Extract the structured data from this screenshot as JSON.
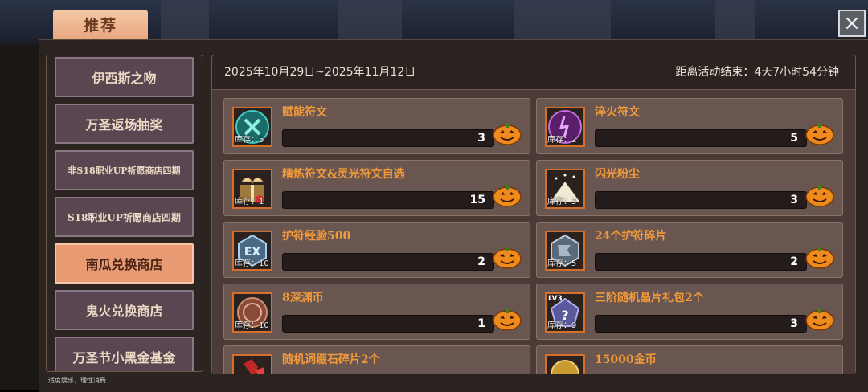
{
  "header": {
    "tab_label": "推荐",
    "close_symbol": "×"
  },
  "sidebar": {
    "items": [
      {
        "label": "伊西斯之吻",
        "active": false
      },
      {
        "label": "万圣返场抽奖",
        "active": false
      },
      {
        "label": "非S18职业UP祈愿商店四期",
        "active": false
      },
      {
        "label": "S18职业UP祈愿商店四期",
        "active": false
      },
      {
        "label": "南瓜兑换商店",
        "active": true
      },
      {
        "label": "鬼火兑换商店",
        "active": false
      },
      {
        "label": "万圣节小黑金基金",
        "active": false
      }
    ],
    "footnote": "适度娱乐，理性消费"
  },
  "event": {
    "date_range": "2025年10月29日~2025年11月12日",
    "countdown": "距离活动结束：4天7小时54分钟"
  },
  "shop": {
    "currency_icon": "pumpkin-icon",
    "items": [
      {
        "name": "赋能符文",
        "stock": "库存：5",
        "price": "3",
        "icon": "rune-teal-icon"
      },
      {
        "name": "淬火符文",
        "stock": "库存：2",
        "price": "5",
        "icon": "rune-purple-icon"
      },
      {
        "name": "精炼符文&灵光符文自选",
        "stock": "库存：1",
        "price": "15",
        "icon": "gift-box-icon"
      },
      {
        "name": "闪光粉尘",
        "stock": "库存：3",
        "price": "3",
        "icon": "dust-pile-icon"
      },
      {
        "name": "护符经验500",
        "stock": "库存：10",
        "price": "2",
        "icon": "ex-gem-icon"
      },
      {
        "name": "24个护符碎片",
        "stock": "库存：5",
        "price": "2",
        "icon": "amulet-shard-icon"
      },
      {
        "name": "8深渊币",
        "stock": "库存：10",
        "price": "1",
        "icon": "abyss-coin-icon"
      },
      {
        "name": "三阶随机晶片礼包2个",
        "stock": "库存：9",
        "price": "3",
        "icon": "lv3-chip-icon",
        "badge": "LV3"
      },
      {
        "name": "随机词缀石碎片2个",
        "stock": "",
        "price": "",
        "icon": "red-crystal-icon"
      },
      {
        "name": "15000金币",
        "stock": "",
        "price": "",
        "icon": "gold-coin-icon"
      }
    ]
  }
}
